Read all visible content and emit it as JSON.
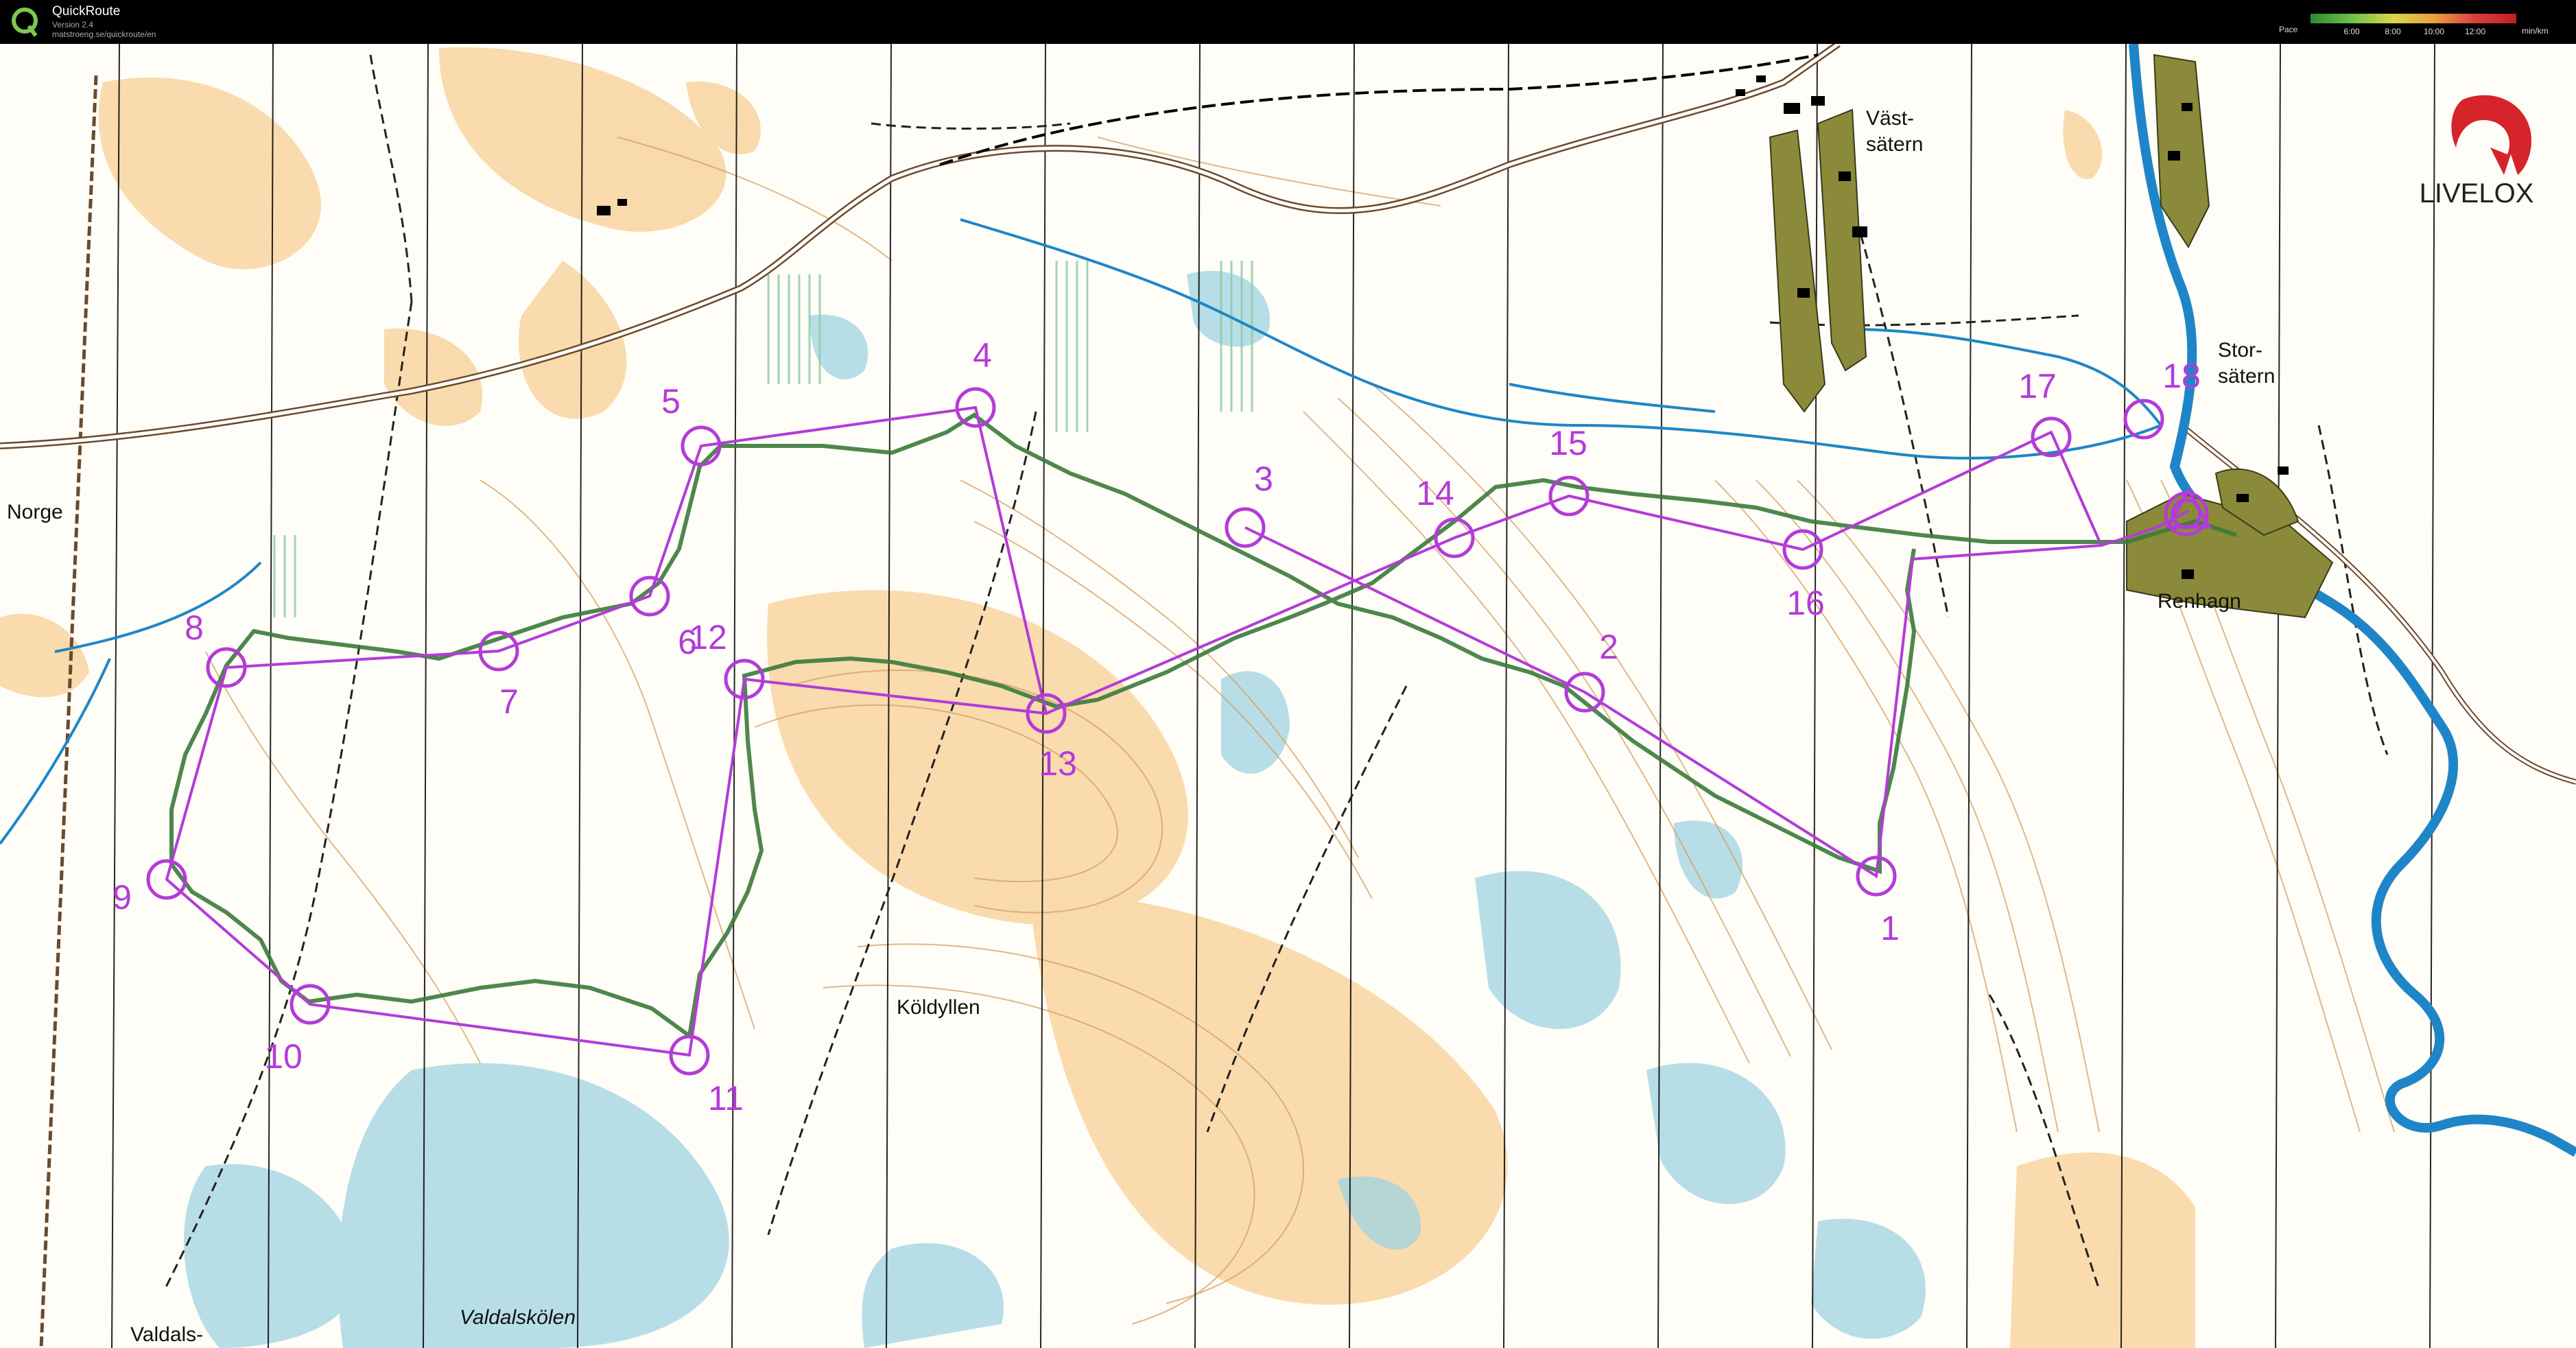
{
  "app": {
    "title": "QuickRoute",
    "version": "Version 2.4",
    "url": "matstroeng.se/quickroute/en"
  },
  "pace_legend": {
    "label": "Pace",
    "ticks": [
      "6:00",
      "8:00",
      "10:00",
      "12:00"
    ],
    "unit": "min/km",
    "colors": [
      "#2e8b2e",
      "#6cc04a",
      "#d8d84a",
      "#e8a040",
      "#d84040"
    ]
  },
  "map": {
    "place_names": {
      "norge": "Norge",
      "vastsatern_1": "Väst-",
      "vastsatern_2": "sätern",
      "storsatern_1": "Stor-",
      "storsatern_2": "sätern",
      "renhagn": "Renhagn",
      "koldyllen": "Köldyllen",
      "valdalskolen": "Valdalskölen",
      "valdals": "Valdals-"
    },
    "controls": [
      {
        "n": "1",
        "label": "1"
      },
      {
        "n": "2",
        "label": "2"
      },
      {
        "n": "3",
        "label": "3"
      },
      {
        "n": "4",
        "label": "4"
      },
      {
        "n": "5",
        "label": "5"
      },
      {
        "n": "6",
        "label": "6"
      },
      {
        "n": "7",
        "label": "7"
      },
      {
        "n": "8",
        "label": "8"
      },
      {
        "n": "9",
        "label": "9"
      },
      {
        "n": "10",
        "label": "10"
      },
      {
        "n": "11",
        "label": "11"
      },
      {
        "n": "12",
        "label": "12"
      },
      {
        "n": "13",
        "label": "13"
      },
      {
        "n": "14",
        "label": "14"
      },
      {
        "n": "15",
        "label": "15"
      },
      {
        "n": "16",
        "label": "16"
      },
      {
        "n": "17",
        "label": "17"
      },
      {
        "n": "18",
        "label": "18"
      }
    ],
    "course_color": "#b33bd9",
    "route_color": "#3a7a3a",
    "water_color": "#1e86c8",
    "open_land_color": "#f7c98a",
    "marsh_color": "#8fd0e0"
  },
  "brand": {
    "name": "LIVELOX",
    "accent": "#d5242a"
  }
}
